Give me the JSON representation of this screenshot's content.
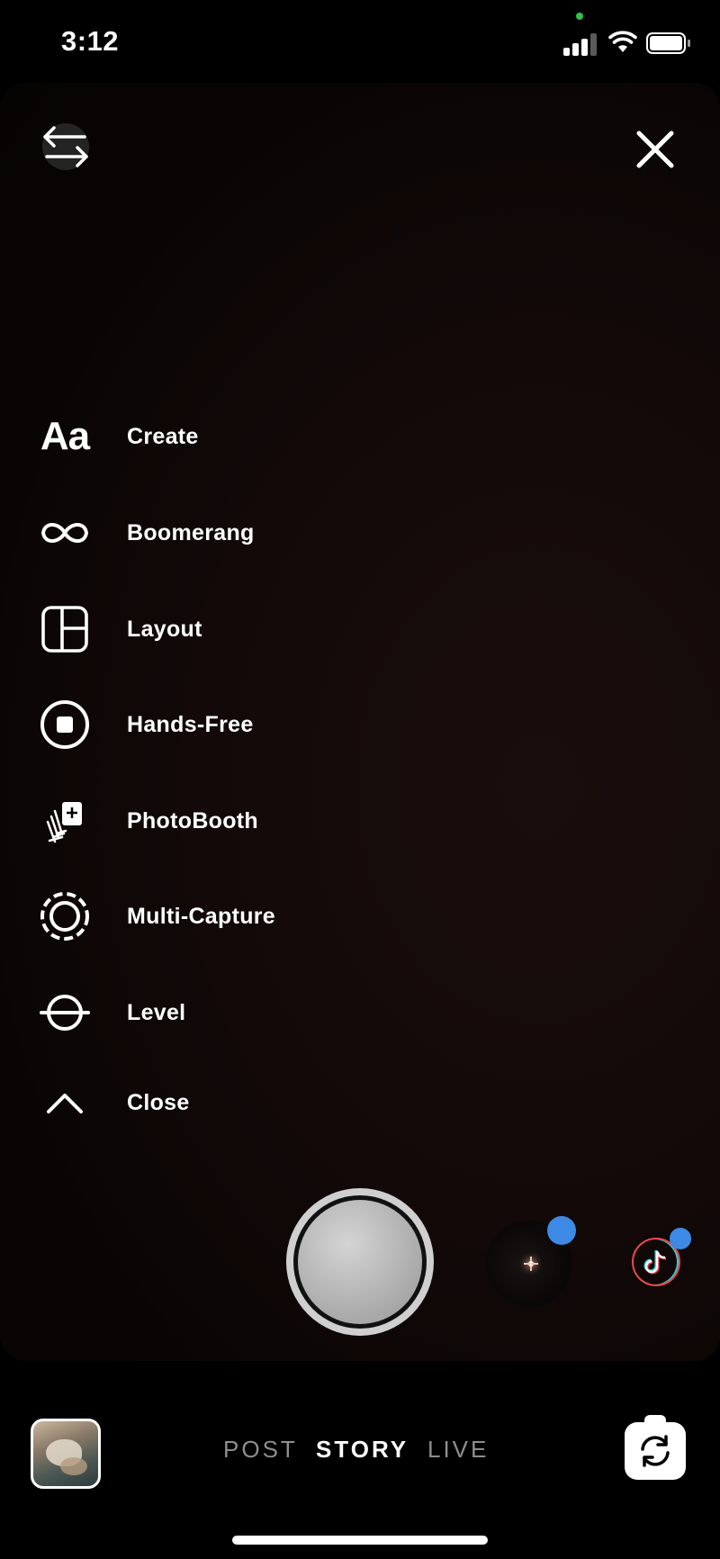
{
  "status_bar": {
    "time": "3:12",
    "icons": [
      "cellular-signal-icon",
      "wifi-icon",
      "battery-icon"
    ],
    "privacy_dot_color": "#31c24b"
  },
  "top_controls": {
    "left_icon": "switch-arrows-icon",
    "right_icon": "close-icon"
  },
  "tools": [
    {
      "icon": "aa-text-icon",
      "glyph": "Aa",
      "label": "Create"
    },
    {
      "icon": "infinity-icon",
      "label": "Boomerang"
    },
    {
      "icon": "layout-grid-icon",
      "label": "Layout"
    },
    {
      "icon": "hands-free-icon",
      "label": "Hands-Free"
    },
    {
      "icon": "photobooth-icon",
      "label": "PhotoBooth"
    },
    {
      "icon": "multi-capture-icon",
      "label": "Multi-Capture"
    },
    {
      "icon": "level-icon",
      "label": "Level"
    },
    {
      "icon": "chevron-up-icon",
      "label": "Close"
    }
  ],
  "capture": {
    "shutter_icon": "shutter-button",
    "effects": [
      "sparkle-effect-icon",
      "tiktok-effect-icon"
    ],
    "badge_color": "#3d8ae6"
  },
  "modes": {
    "post": "POST",
    "story": "STORY",
    "live": "LIVE",
    "selected": "STORY"
  },
  "bottom": {
    "gallery_icon": "gallery-thumbnail",
    "flip_icon": "camera-flip-icon"
  }
}
